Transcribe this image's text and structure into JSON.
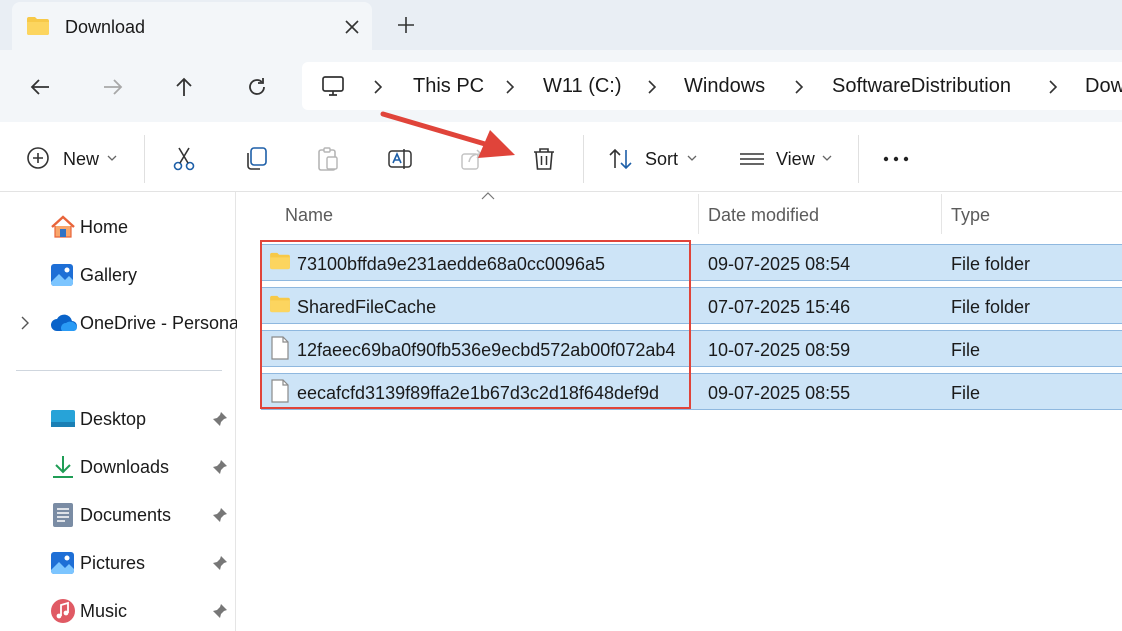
{
  "tab": {
    "title": "Download"
  },
  "nav": {
    "breadcrumbs": [
      "This PC",
      "W11 (C:)",
      "Windows",
      "SoftwareDistribution",
      "Download"
    ]
  },
  "commands": {
    "new_label": "New",
    "sort_label": "Sort",
    "view_label": "View"
  },
  "sidebar": {
    "items": [
      {
        "label": "Home",
        "icon": "home-icon"
      },
      {
        "label": "Gallery",
        "icon": "gallery-icon"
      },
      {
        "label": "OneDrive - Persona",
        "icon": "onedrive-icon"
      },
      {
        "label": "Desktop",
        "icon": "desktop-icon"
      },
      {
        "label": "Downloads",
        "icon": "downloads-icon"
      },
      {
        "label": "Documents",
        "icon": "documents-icon"
      },
      {
        "label": "Pictures",
        "icon": "pictures-icon"
      },
      {
        "label": "Music",
        "icon": "music-icon"
      }
    ]
  },
  "columns": {
    "name": "Name",
    "date": "Date modified",
    "type": "Type"
  },
  "files": [
    {
      "name": "73100bffda9e231aedde68a0cc0096a5",
      "date": "09-07-2025 08:54",
      "type": "File folder",
      "kind": "folder",
      "selected": true
    },
    {
      "name": "SharedFileCache",
      "date": "07-07-2025 15:46",
      "type": "File folder",
      "kind": "folder",
      "selected": true
    },
    {
      "name": "12faeec69ba0f90fb536e9ecbd572ab00f072ab4",
      "date": "10-07-2025 08:59",
      "type": "File",
      "kind": "file",
      "selected": true
    },
    {
      "name": "eecafcfd3139f89ffa2e1b67d3c2d18f648def9d",
      "date": "09-07-2025 08:55",
      "type": "File",
      "kind": "file",
      "selected": true
    }
  ],
  "colors": {
    "selection": "#cde4f7",
    "annotation": "#e0443a",
    "accent": "#0067c0"
  }
}
